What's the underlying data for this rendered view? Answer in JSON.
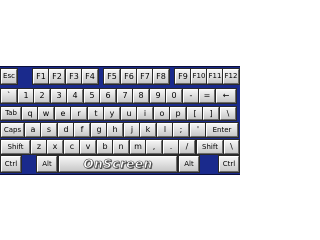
{
  "keyboard": {
    "brand": "OnScreen",
    "rows": [
      [
        "Esc",
        "F1",
        "F2",
        "F3",
        "F4",
        "F5",
        "F6",
        "F7",
        "F8",
        "F9",
        "F10",
        "F11",
        "F12"
      ],
      [
        "`",
        "1",
        "2",
        "3",
        "4",
        "5",
        "6",
        "7",
        "8",
        "9",
        "0",
        "-",
        "=",
        "←"
      ],
      [
        "Tab",
        "q",
        "w",
        "e",
        "r",
        "t",
        "y",
        "u",
        "i",
        "o",
        "p",
        "[",
        "]",
        "\\"
      ],
      [
        "Caps",
        "a",
        "s",
        "d",
        "f",
        "g",
        "h",
        "j",
        "k",
        "l",
        ";",
        "'",
        "Enter"
      ],
      [
        "Shift",
        "z",
        "x",
        "c",
        "v",
        "b",
        "n",
        "m",
        ",",
        ".",
        "/",
        "Shift",
        "\\"
      ],
      [
        "Ctrl",
        "Alt",
        "OnScreen",
        "Alt",
        "Ctrl"
      ]
    ]
  }
}
